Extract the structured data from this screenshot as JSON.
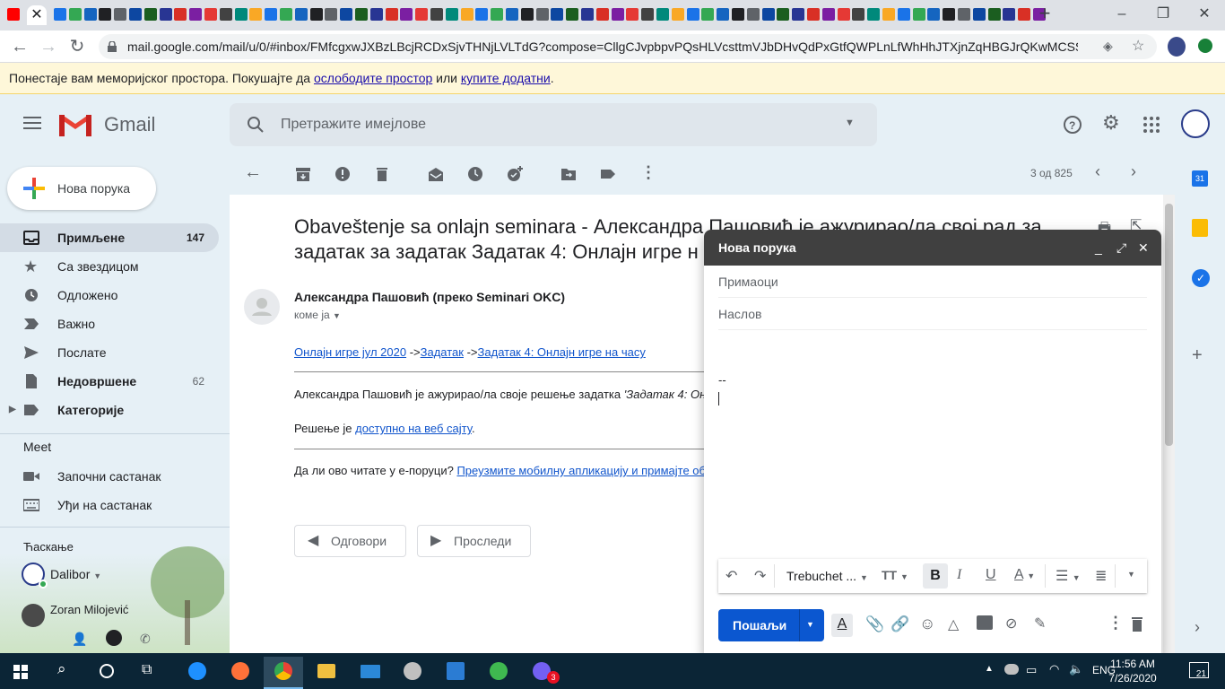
{
  "browser": {
    "url": "mail.google.com/mail/u/0/#inbox/FMfcgxwJXBzLBcjRCDxSjvTHNjLVLTdG?compose=CllgCJvpbpvPQsHLVcsttmVJbDHvQdPxGtfQWPLnLfWhHhJTXjnZqHBGJrQKwMCSSHhlhv...",
    "window_controls": [
      "–",
      "❐",
      "✕"
    ]
  },
  "storage_warning": {
    "text_before": "Понестаје вам меморијског простора. Покушајте да ",
    "link1": "ослободите простор",
    "text_middle": " или ",
    "link2": "купите додатни",
    "text_after": "."
  },
  "gmail": {
    "logo_text": "Gmail",
    "search_placeholder": "Претражите имејлове"
  },
  "sidebar": {
    "compose_label": "Нова порука",
    "items": [
      {
        "label": "Примљене",
        "count": "147",
        "bold": true
      },
      {
        "label": "Са звездицом",
        "count": ""
      },
      {
        "label": "Одложено",
        "count": ""
      },
      {
        "label": "Важно",
        "count": ""
      },
      {
        "label": "Послате",
        "count": ""
      },
      {
        "label": "Недовршене",
        "count": "62",
        "bold": true
      },
      {
        "label": "Категорије",
        "count": "",
        "bold": true
      }
    ],
    "meet_title": "Meet",
    "meet_items": [
      "Започни састанак",
      "Уђи на састанак"
    ],
    "chat_title": "Ћаскање",
    "chat_user": "Dalibor",
    "chat_contact": "Zoran Milojević"
  },
  "mail_toolbar": {
    "pagination": "3 од 825"
  },
  "message": {
    "subject": "Obaveštenje sa onlajn seminara - Александра Пашовић је ажурирао/ла свој рад за задатак за задатак Задатак 4: Онлајн игре н",
    "sender": "Александра Пашовић (преко Seminari OKC)",
    "to_line": "коме ја",
    "breadcrumb": [
      "Онлајн игре јул 2020",
      " ->",
      "Задатак",
      " ->",
      "Задатак 4: Онлајн игре на часу"
    ],
    "body_line1": "Александра Пашовић је ажурирао/ла своје решење задатка ",
    "body_line1_italic": "'Задатак 4: Он",
    "body_line2_prefix": "Решење је ",
    "body_line2_link": "доступно на веб сајту",
    "body_line2_suffix": ".",
    "footer_prefix": "Да ли ово читате у е-поруци? ",
    "footer_link": "Преузмите мобилну апликацију и примајте об",
    "reply_label": "Одговори",
    "forward_label": "Проследи"
  },
  "compose": {
    "title": "Нова порука",
    "to_placeholder": "Примаоци",
    "subject_placeholder": "Наслов",
    "signature": "--",
    "font": "Trebuchet ...",
    "send_label": "Пошаљи"
  },
  "taskbar": {
    "lang": "ENG",
    "time": "11:56 AM",
    "date": "7/26/2020",
    "notif_count": "21",
    "viber_badge": "3"
  }
}
